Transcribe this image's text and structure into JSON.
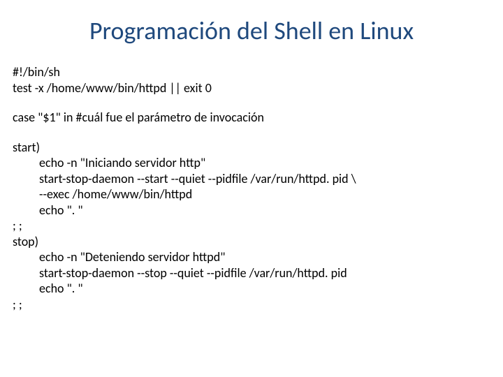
{
  "title": "Programación del Shell en Linux",
  "code": {
    "block1": {
      "l1": "#!/bin/sh",
      "l2": "test -x /home/www/bin/httpd || exit 0"
    },
    "block2": {
      "l1": "case \"$1\" in #cuál fue el parámetro de invocación"
    },
    "block3": {
      "l1": "start)",
      "l2": "echo -n \"Iniciando servidor http\"",
      "l3": "start-stop-daemon --start --quiet --pidfile /var/run/httpd. pid \\",
      "l4": "--exec /home/www/bin/httpd",
      "l5": "echo \". \"",
      "l6": "; ;",
      "l7": "stop)",
      "l8": "echo -n \"Deteniendo servidor httpd\"",
      "l9": "start-stop-daemon --stop --quiet --pidfile /var/run/httpd. pid",
      "l10": "echo \". \"",
      "l11": "; ;"
    }
  }
}
